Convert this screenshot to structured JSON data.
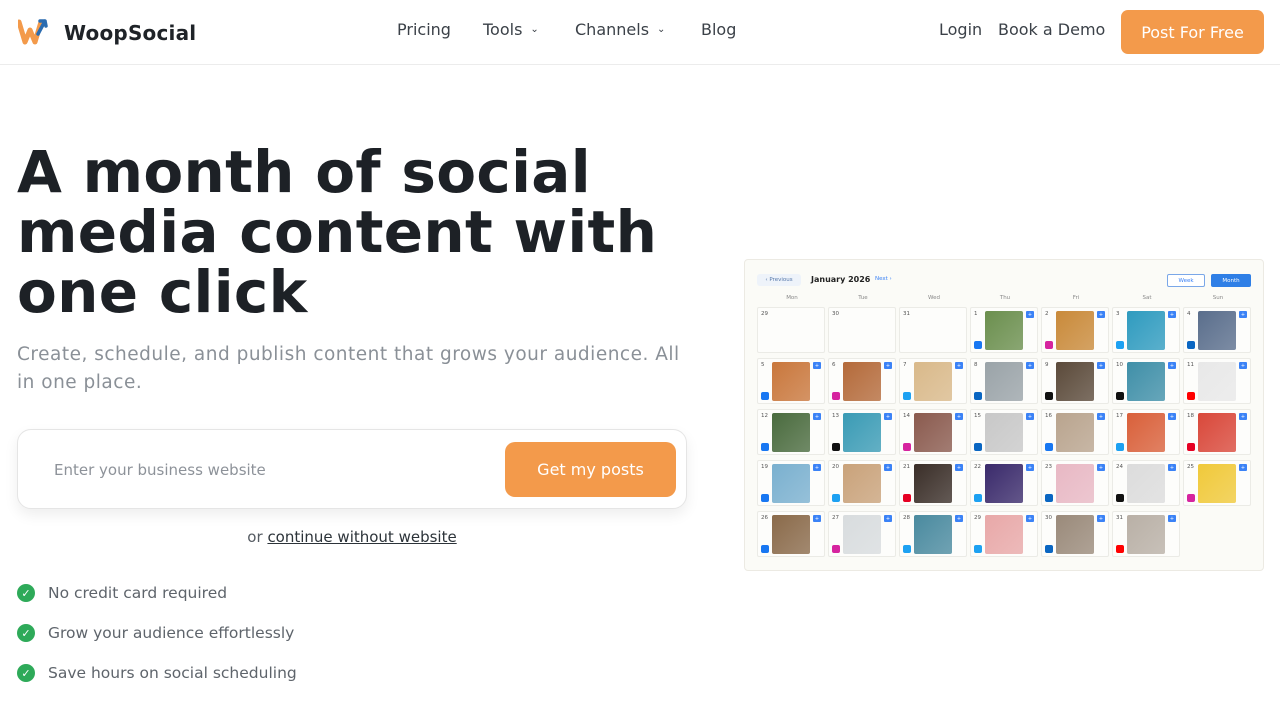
{
  "header": {
    "brand": "WoopSocial",
    "nav": {
      "pricing": "Pricing",
      "tools": "Tools",
      "channels": "Channels",
      "blog": "Blog",
      "login": "Login",
      "book_demo": "Book a Demo",
      "cta": "Post For Free"
    }
  },
  "hero": {
    "headline": "A month of social media content with one click",
    "subhead": "Create, schedule, and publish content that grows your audience. All in one place."
  },
  "form": {
    "placeholder": "Enter your business website",
    "button": "Get my posts",
    "alt_prefix": "or",
    "alt_link": "continue without website"
  },
  "benefits": [
    "No credit card required",
    "Grow your audience effortlessly",
    "Save hours on social scheduling"
  ],
  "calendar": {
    "prev": "‹ Previous",
    "month": "January 2026",
    "next": "Next ›",
    "week": "Week",
    "month_btn": "Month",
    "weekdays": [
      "Mon",
      "Tue",
      "Wed",
      "Thu",
      "Fri",
      "Sat",
      "Sun"
    ],
    "days": [
      {
        "n": "29",
        "img": "",
        "soc": ""
      },
      {
        "n": "30",
        "img": "",
        "soc": ""
      },
      {
        "n": "31",
        "img": "",
        "soc": ""
      },
      {
        "n": "1",
        "img": "#6b8f4e",
        "soc": "#1877f2"
      },
      {
        "n": "2",
        "img": "#c98a3a",
        "soc": "#d6249f"
      },
      {
        "n": "3",
        "img": "#2f9bbf",
        "soc": "#1da1f2"
      },
      {
        "n": "4",
        "img": "#5a6e8c",
        "soc": "#0a66c2"
      },
      {
        "n": "5",
        "img": "#c9773c",
        "soc": "#1877f2"
      },
      {
        "n": "6",
        "img": "#b46a3a",
        "soc": "#d6249f"
      },
      {
        "n": "7",
        "img": "#d9b98a",
        "soc": "#1da1f2"
      },
      {
        "n": "8",
        "img": "#9aa3a8",
        "soc": "#0a66c2"
      },
      {
        "n": "9",
        "img": "#5b4a3a",
        "soc": "#111111"
      },
      {
        "n": "10",
        "img": "#3f8fa8",
        "soc": "#111111"
      },
      {
        "n": "11",
        "img": "#e8e8e8",
        "soc": "#ff0000"
      },
      {
        "n": "12",
        "img": "#4a6b3e",
        "soc": "#1877f2"
      },
      {
        "n": "13",
        "img": "#3a9bb5",
        "soc": "#111111"
      },
      {
        "n": "14",
        "img": "#8a5a4e",
        "soc": "#d6249f"
      },
      {
        "n": "15",
        "img": "#c8c8c8",
        "soc": "#0a66c2"
      },
      {
        "n": "16",
        "img": "#b9a48e",
        "soc": "#1877f2"
      },
      {
        "n": "17",
        "img": "#d9603a",
        "soc": "#1da1f2"
      },
      {
        "n": "18",
        "img": "#d9483a",
        "soc": "#e60023"
      },
      {
        "n": "19",
        "img": "#7ab0cf",
        "soc": "#1877f2"
      },
      {
        "n": "20",
        "img": "#c9a27a",
        "soc": "#1da1f2"
      },
      {
        "n": "21",
        "img": "#3a2e28",
        "soc": "#e60023"
      },
      {
        "n": "22",
        "img": "#3a2a6b",
        "soc": "#1da1f2"
      },
      {
        "n": "23",
        "img": "#e8b8c4",
        "soc": "#0a66c2"
      },
      {
        "n": "24",
        "img": "#dcdcdc",
        "soc": "#111111"
      },
      {
        "n": "25",
        "img": "#f0c93a",
        "soc": "#d6249f"
      },
      {
        "n": "26",
        "img": "#8a6a4a",
        "soc": "#1877f2"
      },
      {
        "n": "27",
        "img": "#d8dcde",
        "soc": "#d6249f"
      },
      {
        "n": "28",
        "img": "#4a8a9f",
        "soc": "#1da1f2"
      },
      {
        "n": "29",
        "img": "#e8a8a8",
        "soc": "#1da1f2"
      },
      {
        "n": "30",
        "img": "#9a8a7a",
        "soc": "#0a66c2"
      },
      {
        "n": "31",
        "img": "#b9b0a6",
        "soc": "#ff0000"
      }
    ]
  },
  "colors": {
    "accent": "#f39a4b",
    "check": "#2eaa59",
    "calendar_blue": "#3b82f6"
  }
}
